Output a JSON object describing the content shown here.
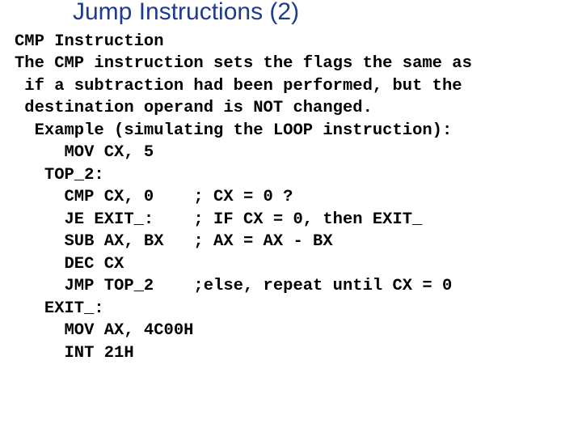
{
  "title": "Jump Instructions (2)",
  "lines": [
    "CMP Instruction",
    "The CMP instruction sets the flags the same as",
    " if a subtraction had been performed, but the",
    " destination operand is NOT changed.",
    "  Example (simulating the LOOP instruction):",
    "     MOV CX, 5",
    "   TOP_2:",
    "     CMP CX, 0    ; CX = 0 ?",
    "     JE EXIT_:    ; IF CX = 0, then EXIT_",
    "     SUB AX, BX   ; AX = AX - BX",
    "     DEC CX",
    "     JMP TOP_2    ;else, repeat until CX = 0",
    "   EXIT_:",
    "     MOV AX, 4C00H",
    "     INT 21H"
  ]
}
